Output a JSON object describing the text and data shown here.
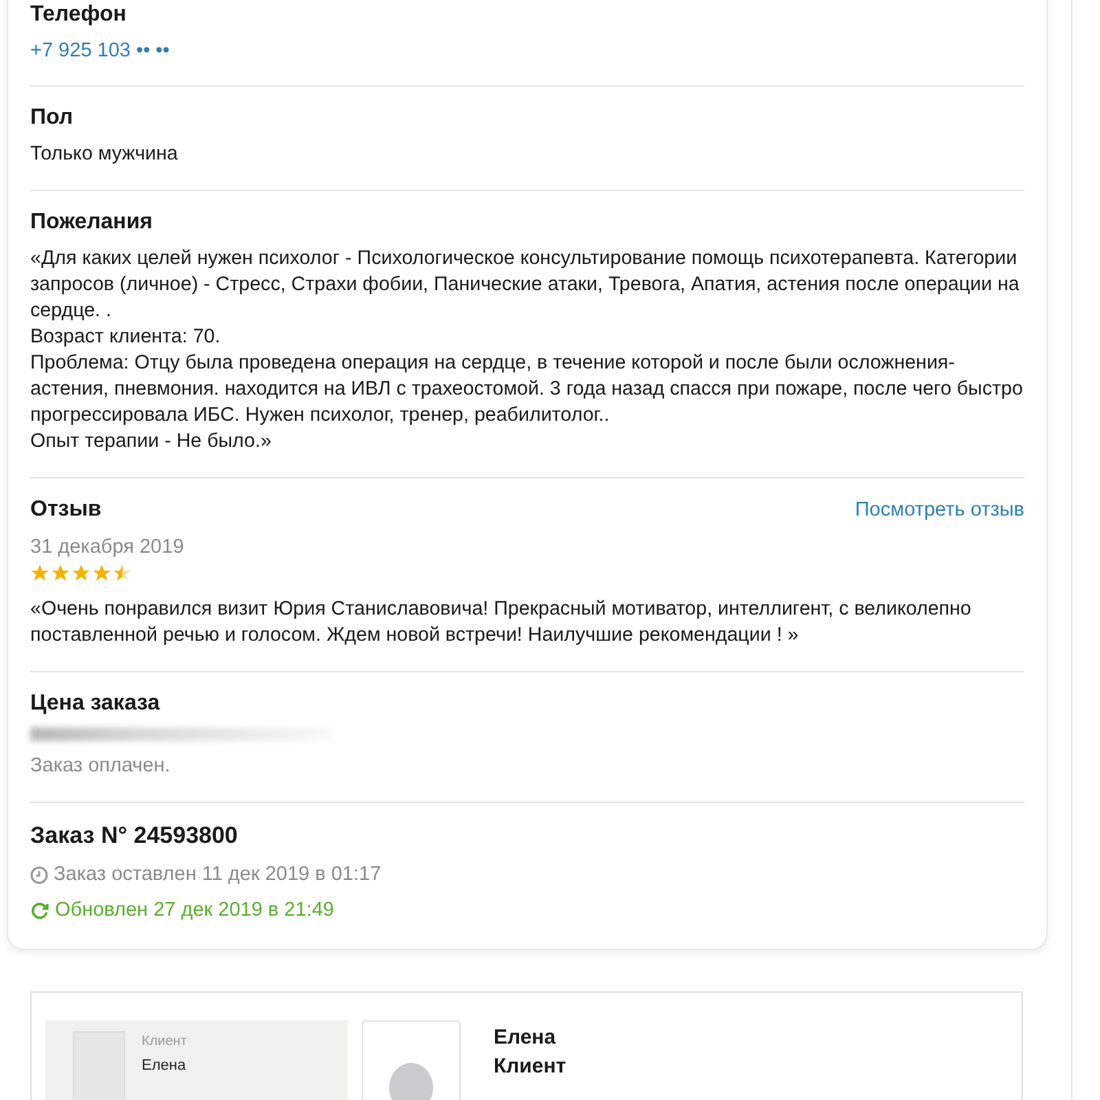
{
  "sections": [
    {
      "kind": "phone",
      "title": "Телефон",
      "value": "+7 925 103 •• ••"
    },
    {
      "kind": "text",
      "title": "Пол",
      "lines": [
        "Только мужчина"
      ]
    },
    {
      "kind": "text",
      "title": "Пожелания",
      "lines": [
        "«Для каких целей нужен психолог - Психологическое консультирование помощь психотерапевта. Категории запросов (личное) - Стресс, Страхи фобии, Панические атаки, Тревога, Апатия, астения после операции на сердце. .",
        "Возраст клиента: 70.",
        "Проблема: Отцу была проведена операция на сердце, в течение которой и после были осложнения- астения, пневмония. находится на ИВЛ с трахеостомой. 3 года назад спасся при пожаре, после чего быстро прогрессировала ИБС. Нужен психолог, тренер, реабилитолог..",
        "Опыт терапии - Не было.»"
      ]
    },
    {
      "kind": "review",
      "title": "Отзыв",
      "link": "Посмотреть отзыв",
      "date": "31 декабря 2019",
      "stars": 4.5,
      "text": "«Очень понравился визит Юрия Станиславовича! Прекрасный мотиватор, интеллигент, с великолепно поставленной речью и голосом. Ждем новой встречи! Наилучшие рекомендации ! »"
    },
    {
      "kind": "price",
      "title": "Цена заказа",
      "note": "Заказ оплачен."
    },
    {
      "kind": "order",
      "title": "Заказ N° 24593800",
      "created": "Заказ оставлен 11 дек 2019 в 01:17",
      "updated": "Обновлен 27 дек 2019 в 21:49"
    }
  ],
  "client_panel": {
    "label": "Клиент",
    "name": "Елена"
  },
  "profile": {
    "name": "Елена",
    "role": "Клиент"
  }
}
